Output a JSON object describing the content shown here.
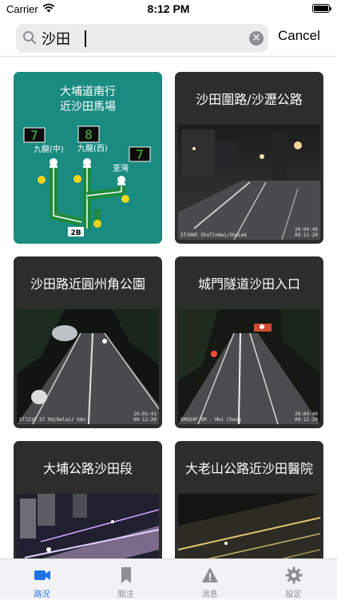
{
  "status_bar": {
    "carrier": "Carrier",
    "time": "8:12 PM"
  },
  "search": {
    "value": "沙田",
    "cancel_label": "Cancel"
  },
  "cards": [
    {
      "title": "大埔道南行近沙田馬場",
      "type": "map",
      "map": {
        "line1": "大埔道南行",
        "line2": "近沙田馬場",
        "sign_left": "7",
        "sign_mid": "8",
        "sign_right": "7",
        "dest_left": "九龍(中)",
        "dest_mid": "九龍(西)",
        "dest_right": "荃灣",
        "route": "2B"
      }
    },
    {
      "title": "沙田圍路/沙瀝公路",
      "type": "camera",
      "osd_code": "ST106F ShaTinWai/ShaLek",
      "osd_time": "20:04:40",
      "osd_date": "09-12-20"
    },
    {
      "title": "沙田路近圓州角公園",
      "type": "camera",
      "osd_code": "ST721F ST Rd/Belair Gdn",
      "osd_time": "20:05:41",
      "osd_date": "09-12-20"
    },
    {
      "title": "城門隧道沙田入口",
      "type": "camera",
      "osd_code": "SM934F SM - Mei Chung",
      "osd_time": "20:04:40",
      "osd_date": "09-12-20"
    },
    {
      "title": "大埔公路沙田段",
      "type": "camera"
    },
    {
      "title": "大老山公路近沙田醫院",
      "type": "camera"
    }
  ],
  "tabs": [
    {
      "label": "路況",
      "icon": "video-camera-icon",
      "active": true
    },
    {
      "label": "關注",
      "icon": "bookmark-icon",
      "active": false
    },
    {
      "label": "消息",
      "icon": "warning-icon",
      "active": false
    },
    {
      "label": "設定",
      "icon": "gear-icon",
      "active": false
    }
  ],
  "colors": {
    "accent": "#1f75e4",
    "card_bg": "#2d2d2d",
    "map_bg": "#1a8b80",
    "route_green": "#1e8a3a",
    "sign_green": "#45c13a"
  }
}
